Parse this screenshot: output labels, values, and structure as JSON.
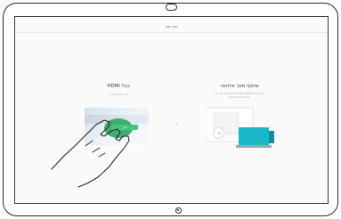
{
  "screen": {
    "title": "שתף מסך"
  },
  "hdmi_option": {
    "heading": "כבל HDMI",
    "subtext": "חבר את המחשב...",
    "button_label": "שתף"
  },
  "wireless_option": {
    "heading": "שיתוף מסך אלחוטי",
    "subtext": "התקן את Proximity/Cisco Webex, חבר את המחשב לאותה רשת"
  },
  "or_label": "או",
  "colors": {
    "accent_green": "#46c37b",
    "accent_teal": "#19b7c9",
    "frame": "#2a2a2a"
  },
  "icons": {
    "share": "share-icon",
    "home": "home-button-icon",
    "camera": "camera-icon"
  }
}
